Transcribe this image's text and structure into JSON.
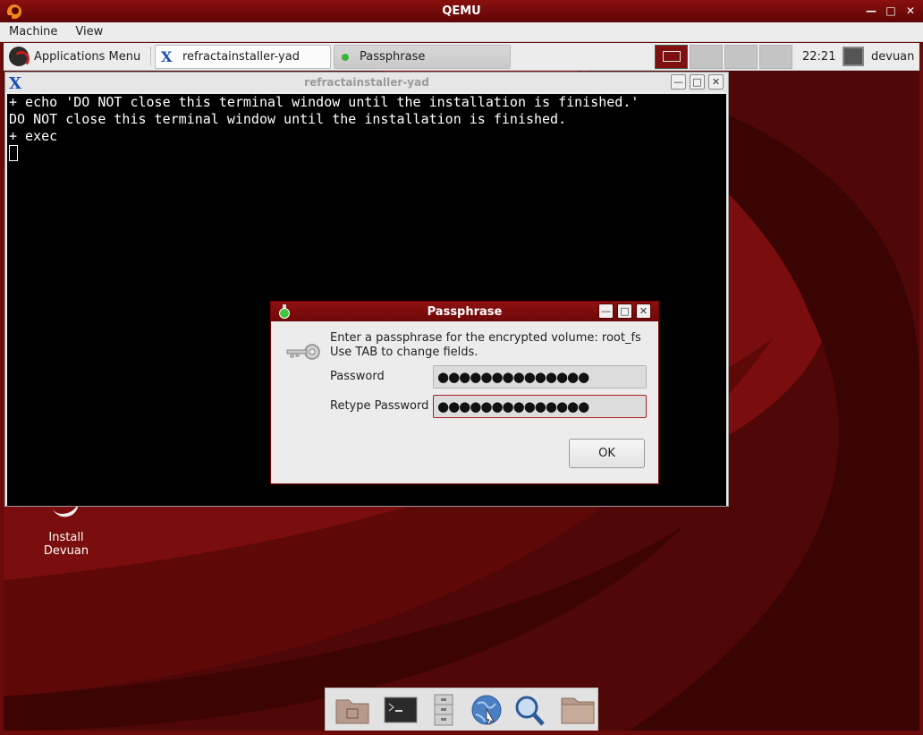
{
  "qemu": {
    "title": "QEMU",
    "menu": [
      "Machine",
      "View"
    ],
    "controls": [
      "minimize",
      "maximize",
      "close"
    ]
  },
  "panel": {
    "apps_menu_label": "Applications Menu",
    "tasks": [
      {
        "label": "refractainstaller-yad",
        "icon": "x-terminal-icon",
        "active": false
      },
      {
        "label": "Passphrase",
        "icon": "green-dot-icon",
        "active": true
      }
    ],
    "clock": "22:21",
    "user": "devuan"
  },
  "desktop": {
    "icon_label_line1": "Install",
    "icon_label_line2": "Devuan"
  },
  "terminal": {
    "title": "refractainstaller-yad",
    "lines": [
      "+ echo 'DO NOT close this terminal window until the installation is finished.'",
      "DO NOT close this terminal window until the installation is finished.",
      "+ exec"
    ]
  },
  "dialog": {
    "title": "Passphrase",
    "message_line1": "Enter a passphrase for the encrypted volume: root_fs",
    "message_line2": "Use TAB to change fields.",
    "password_label": "Password",
    "password_value": "●●●●●●●●●●●●●●",
    "retype_label": "Retype Password",
    "retype_value": "●●●●●●●●●●●●●●",
    "ok_label": "OK"
  },
  "dock": {
    "items": [
      "home-folder-icon",
      "terminal-icon",
      "file-cabinet-icon",
      "web-browser-icon",
      "search-icon",
      "folder-icon"
    ]
  },
  "colors": {
    "accent": "#8e1111",
    "panel": "#ececec",
    "terminal_bg": "#000000"
  }
}
